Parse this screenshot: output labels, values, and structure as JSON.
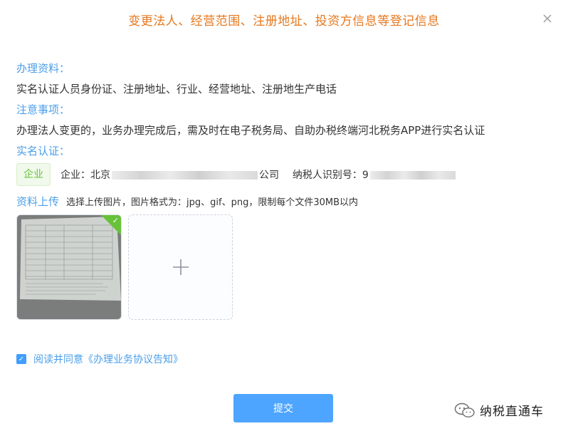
{
  "dialog": {
    "title": "变更法人、经营范围、注册地址、投资方信息等登记信息",
    "close_icon": "close-icon"
  },
  "materials": {
    "label": "办理资料：",
    "text": "实名认证人员身份证、注册地址、行业、经营地址、注册地生产电话"
  },
  "notes": {
    "label": "注意事项：",
    "text": "办理法人变更的，业务办理完成后，需及时在电子税务局、自助办税终端河北税务APP进行实名认证"
  },
  "verification": {
    "label": "实名认证：",
    "tag": "企业",
    "company_prefix": "企业：北京",
    "company_suffix": "公司",
    "taxid_prefix": "纳税人识别号：9"
  },
  "upload": {
    "label": "资料上传",
    "hint": "选择上传图片，图片格式为：jpg、gif、png，限制每个文件30MB以内",
    "add_icon": "plus-icon",
    "uploaded_status_icon": "check-icon"
  },
  "agreement": {
    "checked": true,
    "text": "阅读并同意《办理业务协议告知》"
  },
  "submit_label": "提交",
  "watermark": {
    "text": "纳税直通车",
    "icon": "wechat-icon"
  },
  "colors": {
    "title": "#e6781e",
    "label": "#4a9ee8",
    "tag_green": "#67c23a",
    "primary_button": "#4ea5ff"
  }
}
